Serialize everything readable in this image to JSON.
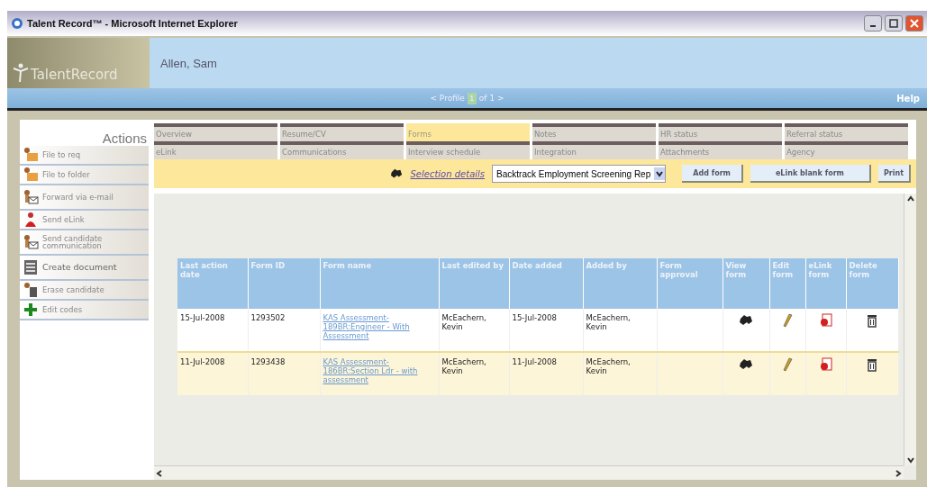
{
  "window": {
    "title": "Talent Record™ - Microsoft Internet Explorer"
  },
  "header": {
    "logo": "TalentRecord",
    "candidate": "Allen, Sam",
    "nav_prev": "< Profile",
    "nav_index": "1",
    "nav_next": "of 1 >",
    "help": "Help"
  },
  "sidebar": {
    "title": "Actions",
    "items": [
      {
        "label": "File to req",
        "kind": "folder"
      },
      {
        "label": "File to folder",
        "kind": "folder"
      },
      {
        "label": "Forward via e-mail",
        "kind": "mail"
      },
      {
        "label": "Send eLink",
        "kind": "elink"
      },
      {
        "label": "Send candidate communication",
        "kind": "mail"
      },
      {
        "label": "Create document",
        "kind": "document"
      },
      {
        "label": "Erase candidate",
        "kind": "erase"
      },
      {
        "label": "Edit codes",
        "kind": "plus"
      }
    ]
  },
  "tabs": [
    [
      {
        "label": "Overview",
        "selected": false
      },
      {
        "label": "Resume/CV",
        "selected": false
      },
      {
        "label": "Forms",
        "selected": true
      },
      {
        "label": "Notes",
        "selected": false
      },
      {
        "label": "HR status",
        "selected": false
      },
      {
        "label": "Referral status",
        "selected": false
      }
    ],
    [
      {
        "label": "eLink",
        "selected": false
      },
      {
        "label": "Communications",
        "selected": false
      },
      {
        "label": "Interview schedule",
        "selected": false
      },
      {
        "label": "Integration",
        "selected": false
      },
      {
        "label": "Attachments",
        "selected": false
      },
      {
        "label": "Agency",
        "selected": false
      }
    ]
  ],
  "toolbar": {
    "selection_link": "Selection details",
    "form_select": "Backtrack Employment Screening Rep",
    "buttons": [
      "Add form",
      "eLink blank form",
      "Print"
    ]
  },
  "table": {
    "columns": [
      "Last action date",
      "Form ID",
      "Form name",
      "Last edited by",
      "Date added",
      "Added by",
      "Form approval",
      "View form",
      "Edit form",
      "eLink form",
      "Delete form"
    ],
    "rows": [
      {
        "selected": false,
        "cells": [
          "15-Jul-2008",
          "1293502",
          "KAS Assessment-189BR:Engineer - With Assessment",
          "McEachern, Kevin",
          "15-Jul-2008",
          "McEachern, Kevin"
        ]
      },
      {
        "selected": true,
        "cells": [
          "11-Jul-2008",
          "1293438",
          "KAS Assessment-186BR:Section Ldr - with assessment",
          "McEachern, Kevin",
          "11-Jul-2008",
          "McEachern, Kevin"
        ]
      }
    ]
  }
}
